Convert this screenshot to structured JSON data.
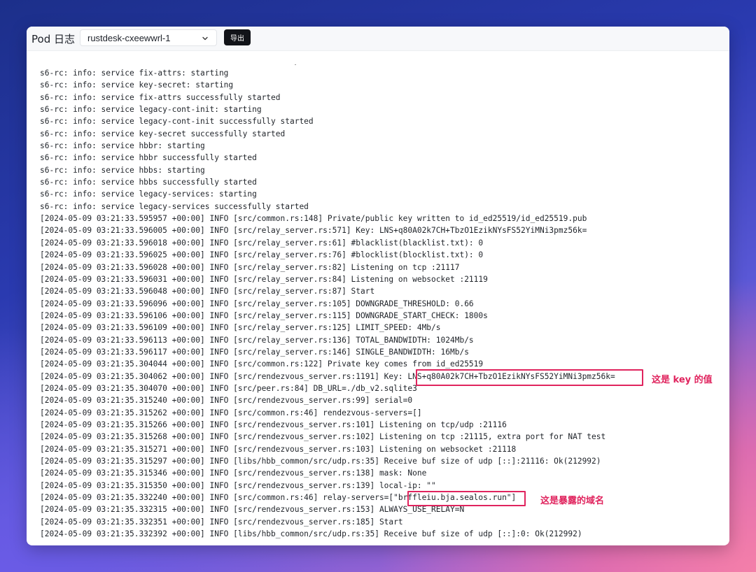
{
  "header": {
    "title": "Pod 日志",
    "pod_select": {
      "value": "rustdesk-cxeewwrl-1"
    },
    "export_label": "导出"
  },
  "log_lines": [
    "s6-rc: info: service fix-attrs: starting",
    "s6-rc: info: service key-secret: starting",
    "s6-rc: info: service fix-attrs successfully started",
    "s6-rc: info: service legacy-cont-init: starting",
    "s6-rc: info: service legacy-cont-init successfully started",
    "s6-rc: info: service key-secret successfully started",
    "s6-rc: info: service hbbr: starting",
    "s6-rc: info: service hbbr successfully started",
    "s6-rc: info: service hbbs: starting",
    "s6-rc: info: service hbbs successfully started",
    "s6-rc: info: service legacy-services: starting",
    "s6-rc: info: service legacy-services successfully started",
    "[2024-05-09 03:21:33.595957 +00:00] INFO [src/common.rs:148] Private/public key written to id_ed25519/id_ed25519.pub",
    "[2024-05-09 03:21:33.596005 +00:00] INFO [src/relay_server.rs:571] Key: LNS+q80A02k7CH+TbzO1EzikNYsFS52YiMNi3pmz56k=",
    "[2024-05-09 03:21:33.596018 +00:00] INFO [src/relay_server.rs:61] #blacklist(blacklist.txt): 0",
    "[2024-05-09 03:21:33.596025 +00:00] INFO [src/relay_server.rs:76] #blocklist(blocklist.txt): 0",
    "[2024-05-09 03:21:33.596028 +00:00] INFO [src/relay_server.rs:82] Listening on tcp :21117",
    "[2024-05-09 03:21:33.596031 +00:00] INFO [src/relay_server.rs:84] Listening on websocket :21119",
    "[2024-05-09 03:21:33.596048 +00:00] INFO [src/relay_server.rs:87] Start",
    "[2024-05-09 03:21:33.596096 +00:00] INFO [src/relay_server.rs:105] DOWNGRADE_THRESHOLD: 0.66",
    "[2024-05-09 03:21:33.596106 +00:00] INFO [src/relay_server.rs:115] DOWNGRADE_START_CHECK: 1800s",
    "[2024-05-09 03:21:33.596109 +00:00] INFO [src/relay_server.rs:125] LIMIT_SPEED: 4Mb/s",
    "[2024-05-09 03:21:33.596113 +00:00] INFO [src/relay_server.rs:136] TOTAL_BANDWIDTH: 1024Mb/s",
    "[2024-05-09 03:21:33.596117 +00:00] INFO [src/relay_server.rs:146] SINGLE_BANDWIDTH: 16Mb/s",
    "[2024-05-09 03:21:35.304044 +00:00] INFO [src/common.rs:122] Private key comes from id_ed25519",
    "[2024-05-09 03:21:35.304062 +00:00] INFO [src/rendezvous_server.rs:1191] Key: LNS+q80A02k7CH+TbzO1EzikNYsFS52YiMNi3pmz56k=",
    "[2024-05-09 03:21:35.304070 +00:00] INFO [src/peer.rs:84] DB_URL=./db_v2.sqlite3",
    "[2024-05-09 03:21:35.315240 +00:00] INFO [src/rendezvous_server.rs:99] serial=0",
    "[2024-05-09 03:21:35.315262 +00:00] INFO [src/common.rs:46] rendezvous-servers=[]",
    "[2024-05-09 03:21:35.315266 +00:00] INFO [src/rendezvous_server.rs:101] Listening on tcp/udp :21116",
    "[2024-05-09 03:21:35.315268 +00:00] INFO [src/rendezvous_server.rs:102] Listening on tcp :21115, extra port for NAT test",
    "[2024-05-09 03:21:35.315271 +00:00] INFO [src/rendezvous_server.rs:103] Listening on websocket :21118",
    "[2024-05-09 03:21:35.315297 +00:00] INFO [libs/hbb_common/src/udp.rs:35] Receive buf size of udp [::]:21116: Ok(212992)",
    "[2024-05-09 03:21:35.315346 +00:00] INFO [src/rendezvous_server.rs:138] mask: None",
    "[2024-05-09 03:21:35.315350 +00:00] INFO [src/rendezvous_server.rs:139] local-ip: \"\"",
    "[2024-05-09 03:21:35.332240 +00:00] INFO [src/common.rs:46] relay-servers=[\"brffleiu.bja.sealos.run\"]",
    "[2024-05-09 03:21:35.332315 +00:00] INFO [src/rendezvous_server.rs:153] ALWAYS_USE_RELAY=N",
    "[2024-05-09 03:21:35.332351 +00:00] INFO [src/rendezvous_server.rs:185] Start",
    "[2024-05-09 03:21:35.332392 +00:00] INFO [libs/hbb_common/src/udp.rs:35] Receive buf size of udp [::]:0: Ok(212992)"
  ],
  "annotations": {
    "key_label": "这是 key 的值",
    "domain_label": "这是暴露的域名"
  },
  "colors": {
    "annotation": "#e0245e",
    "export_button": "#111318"
  }
}
